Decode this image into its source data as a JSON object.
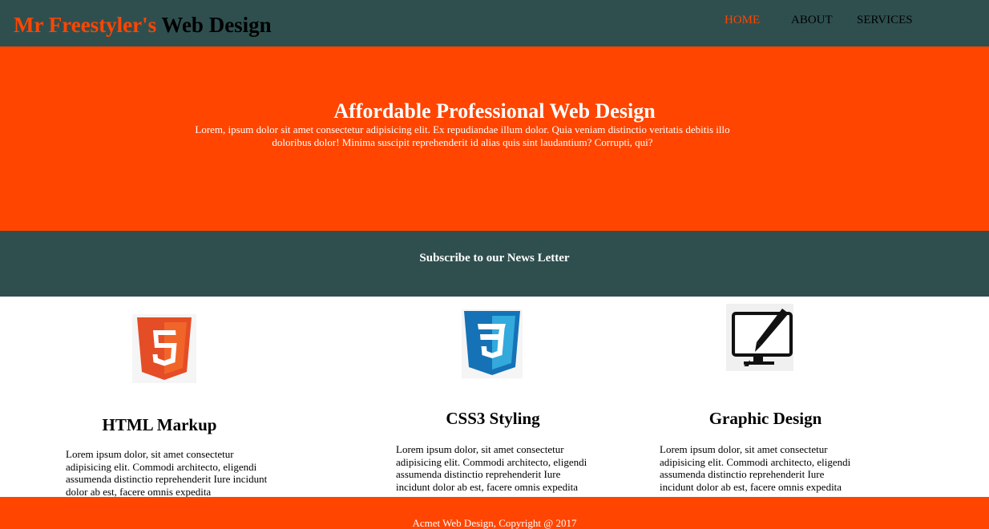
{
  "colors": {
    "header_bg": "#2f4f4f",
    "accent": "#ff4500",
    "text_light": "#ffffff",
    "text_dark": "#000000"
  },
  "header": {
    "brand_highlight": "Mr Freestyler's",
    "brand_rest": " Web Design",
    "nav": [
      {
        "label": "HOME",
        "active": true
      },
      {
        "label": "ABOUT",
        "active": false
      },
      {
        "label": "SERVICES",
        "active": false
      }
    ]
  },
  "hero": {
    "title": "Affordable Professional Web Design",
    "text": "Lorem, ipsum dolor sit amet consectetur adipisicing elit. Ex repudiandae illum dolor. Quia veniam distinctio veritatis debitis illo doloribus dolor! Minima suscipit reprehenderit id alias quis sint laudantium? Corrupti, qui?"
  },
  "newsletter": {
    "title": "Subscribe to our News Letter"
  },
  "features": [
    {
      "icon": "html5-icon",
      "title": "HTML Markup",
      "text": "Lorem ipsum dolor, sit amet consectetur adipisicing elit. Commodi architecto, eligendi assumenda distinctio reprehenderit Iure incidunt dolor ab est, facere omnis expedita"
    },
    {
      "icon": "css3-icon",
      "title": "CSS3 Styling",
      "text": "Lorem ipsum dolor, sit amet consectetur adipisicing elit. Commodi architecto, eligendi assumenda distinctio reprehenderit Iure incidunt dolor ab est, facere omnis expedita"
    },
    {
      "icon": "graphic-design-icon",
      "title": "Graphic Design",
      "text": "Lorem ipsum dolor, sit amet consectetur adipisicing elit. Commodi architecto, eligendi assumenda distinctio reprehenderit Iure incidunt dolor ab est, facere omnis expedita"
    }
  ],
  "footer": {
    "text": "Acmet Web Design, Copyright @ 2017"
  }
}
